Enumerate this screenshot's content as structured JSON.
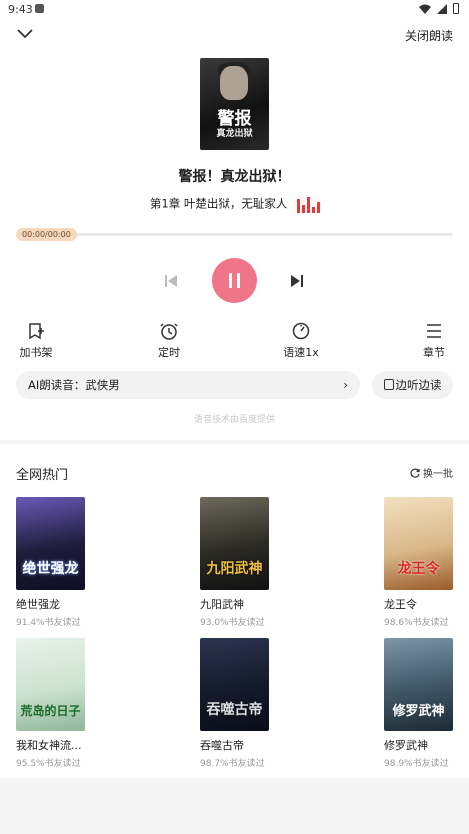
{
  "status_bar": {
    "time": "9:43"
  },
  "header": {
    "close_read_label": "关闭朗读"
  },
  "now_playing": {
    "cover_title": "警报",
    "cover_subtitle": "真龙出狱",
    "book_title": "警报！真龙出狱！",
    "chapter": "第1章 叶楚出狱，无耻家人",
    "progress_time": "00:00/00:00",
    "progress_fraction": 0.0
  },
  "toolbar": {
    "add_shelf": "加书架",
    "timer": "定时",
    "speed": "语速1x",
    "chapters": "章节"
  },
  "voice": {
    "label": "AI朗读音：武侠男",
    "listen_label": "边听边读",
    "powered_by": "语音技术由百度提供"
  },
  "hot": {
    "title": "全网热门",
    "refresh_label": "换一批",
    "books": [
      {
        "name": "绝世强龙",
        "rate": "91.4%书友读过",
        "cover_text": "绝世强龙"
      },
      {
        "name": "九阳武神",
        "rate": "93.0%书友读过",
        "cover_text": "九阳武神"
      },
      {
        "name": "龙王令",
        "rate": "98.6%书友读过",
        "cover_text": "龙王令"
      },
      {
        "name": "我和女神流...",
        "rate": "95.5%书友读过",
        "cover_text": "荒岛的日子"
      },
      {
        "name": "吞噬古帝",
        "rate": "98.7%书友读过",
        "cover_text": "吞噬古帝"
      },
      {
        "name": "修罗武神",
        "rate": "98.9%书友读过",
        "cover_text": "修罗武神"
      }
    ]
  },
  "colors": {
    "play": "#f07588",
    "eq": "#e53935",
    "progress_badge": "#f4d9bd"
  }
}
